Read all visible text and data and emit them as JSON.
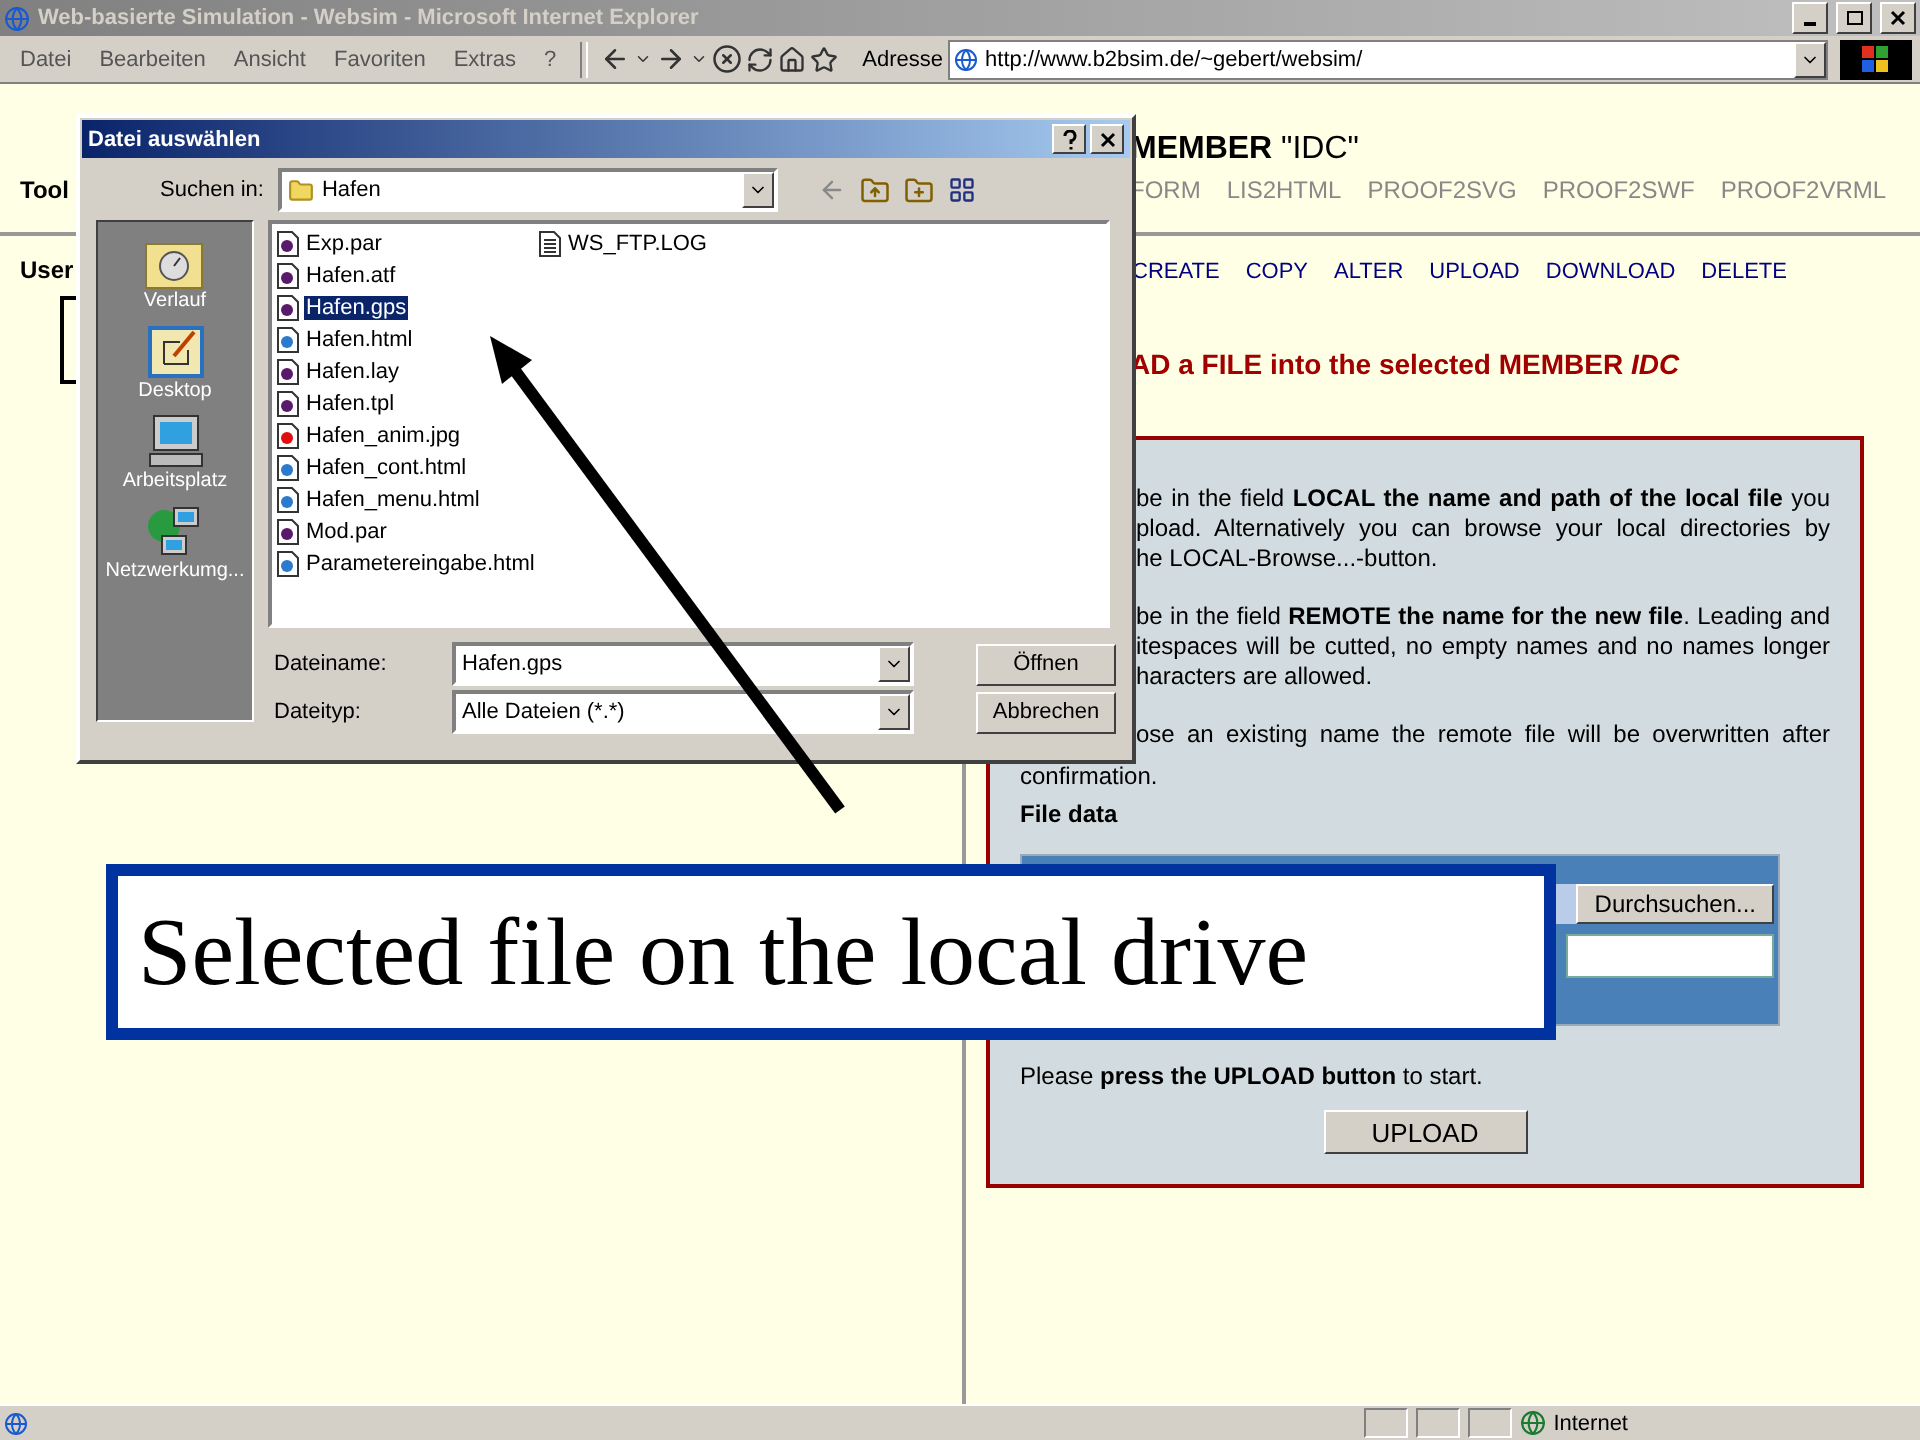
{
  "window": {
    "title": "Web-basierte Simulation - Websim - Microsoft Internet Explorer"
  },
  "menu": [
    "Datei",
    "Bearbeiten",
    "Ansicht",
    "Favoriten",
    "Extras",
    "?"
  ],
  "address": {
    "label": "Adresse",
    "value": "http://www.b2bsim.de/~gebert/websim/"
  },
  "top_frame": {
    "heading": "**MEMBER** \"IDC\"",
    "tool_label": "Tool",
    "tabs": [
      "FORM",
      "LIS2HTML",
      "PROOF2SVG",
      "PROOF2SWF",
      "PROOF2VRML"
    ]
  },
  "left_frame": {
    "label": "User"
  },
  "right_frame": {
    "actions": [
      "CREATE",
      "COPY",
      "ALTER",
      "UPLOAD",
      "DOWNLOAD",
      "DELETE"
    ],
    "heading": "AD a FILE into the selected MEMBER *IDC*",
    "paragraphs": [
      {
        "lines": [
          "be in the field **LOCAL the name and path of the local file** you",
          "pload. Alternatively you can browse your local directories by",
          "he LOCAL-Browse...-button."
        ]
      },
      {
        "lines": [
          "be in the field **REMOTE the name for the new file**. Leading and",
          "itespaces will be cutted, no empty names and no names longer",
          "haracters are allowed."
        ]
      },
      {
        "lines": [
          "ose an existing name the remote file will be overwritten after",
          "confirmation."
        ]
      }
    ],
    "file_data_title": "File data",
    "browse_button": "Durchsuchen...",
    "note": "Please **press the UPLOAD button** to start.",
    "upload_button": "UPLOAD"
  },
  "dialog": {
    "title": "Datei auswählen",
    "look_in_label": "Suchen in:",
    "look_in_value": "Hafen",
    "places": [
      {
        "label": "Verlauf",
        "kind": "history"
      },
      {
        "label": "Desktop",
        "kind": "desktop"
      },
      {
        "label": "Arbeitsplatz",
        "kind": "computer"
      },
      {
        "label": "Netzwerkumg...",
        "kind": "network"
      }
    ],
    "files": [
      {
        "name": "Exp.par",
        "kind": "data",
        "selected": false
      },
      {
        "name": "Hafen.atf",
        "kind": "data",
        "selected": false
      },
      {
        "name": "Hafen.gps",
        "kind": "data",
        "selected": true
      },
      {
        "name": "Hafen.html",
        "kind": "html",
        "selected": false
      },
      {
        "name": "Hafen.lay",
        "kind": "data",
        "selected": false
      },
      {
        "name": "Hafen.tpl",
        "kind": "data",
        "selected": false
      },
      {
        "name": "Hafen_anim.jpg",
        "kind": "image",
        "selected": false
      },
      {
        "name": "Hafen_cont.html",
        "kind": "html",
        "selected": false
      },
      {
        "name": "Hafen_menu.html",
        "kind": "html",
        "selected": false
      },
      {
        "name": "Mod.par",
        "kind": "data",
        "selected": false
      },
      {
        "name": "Parametereingabe.html",
        "kind": "html",
        "selected": false
      },
      {
        "name": "WS_FTP.LOG",
        "kind": "text",
        "selected": false
      }
    ],
    "file_name_label": "Dateiname:",
    "file_name": "Hafen.gps",
    "file_type_label": "Dateityp:",
    "file_type": "Alle Dateien (*.*)",
    "buttons": [
      "Öffnen",
      "Abbrechen"
    ]
  },
  "callout": {
    "text": "Selected file on the local drive"
  },
  "status_bar": {
    "zone": "Internet"
  }
}
